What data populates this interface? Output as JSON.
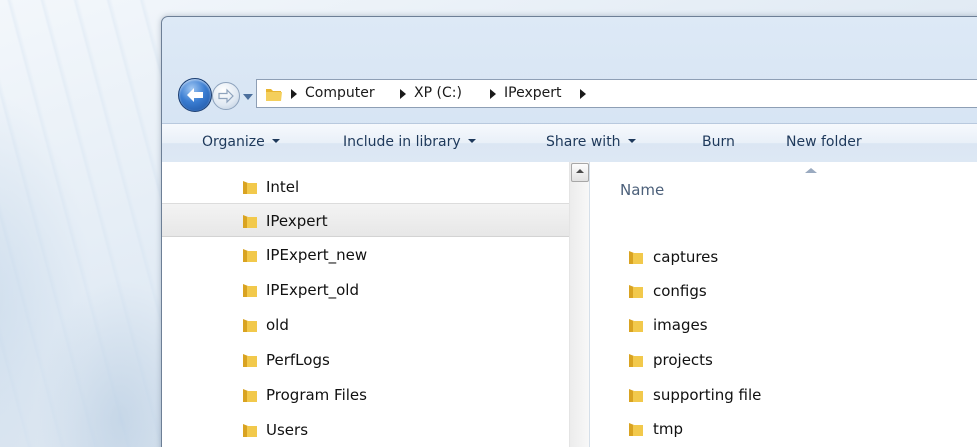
{
  "address_bar": {
    "crumbs": [
      "Computer",
      "XP (C:)",
      "IPexpert"
    ]
  },
  "toolbar": {
    "organize": "Organize",
    "include_in_library": "Include in library",
    "share_with": "Share with",
    "burn": "Burn",
    "new_folder": "New folder"
  },
  "nav_tree": {
    "items": [
      {
        "label": "Intel",
        "selected": false
      },
      {
        "label": "IPexpert",
        "selected": true
      },
      {
        "label": "IPExpert_new",
        "selected": false
      },
      {
        "label": "IPExpert_old",
        "selected": false
      },
      {
        "label": "old",
        "selected": false
      },
      {
        "label": "PerfLogs",
        "selected": false
      },
      {
        "label": "Program Files",
        "selected": false
      },
      {
        "label": "Users",
        "selected": false
      }
    ]
  },
  "content": {
    "column_name": "Name",
    "items": [
      "captures",
      "configs",
      "images",
      "projects",
      "supporting file",
      "tmp"
    ]
  },
  "icons": {
    "back": "back-arrow-icon",
    "forward": "forward-arrow-icon",
    "recent": "chevron-down-icon",
    "folder": "folder-icon"
  },
  "colors": {
    "folder": "#e8b530",
    "toolbar_text": "#1e395b",
    "header_text": "#4c607a"
  }
}
